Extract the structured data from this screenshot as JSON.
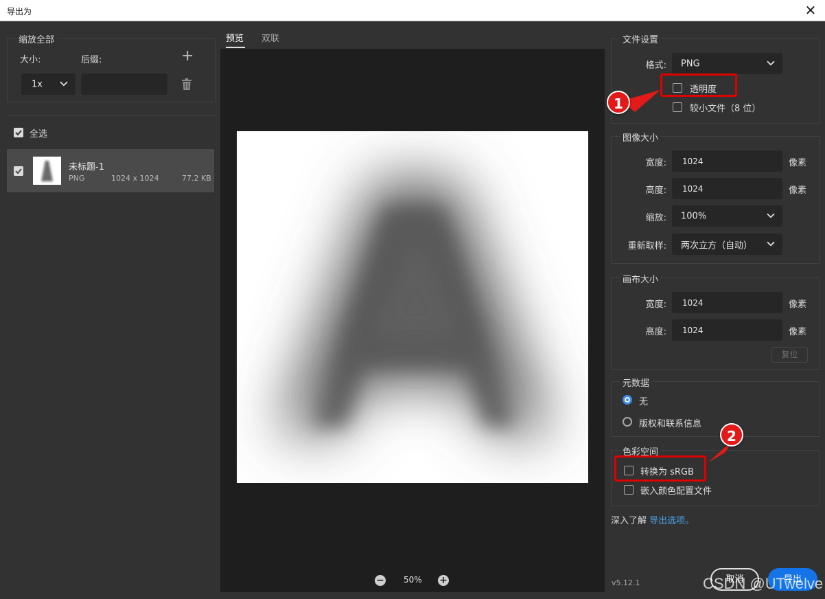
{
  "window": {
    "title": "导出为",
    "close_glyph": "✕"
  },
  "scale_all": {
    "legend": "缩放全部",
    "size_label": "大小:",
    "suffix_label": "后缀:",
    "size_value": "1x",
    "suffix_value": ""
  },
  "assets": {
    "select_all_label": "全选",
    "items": [
      {
        "name": "未标题-1",
        "format": "PNG",
        "dimensions": "1024 x 1024",
        "filesize": "77.2 KB"
      }
    ]
  },
  "preview": {
    "tabs": [
      {
        "label": "预览"
      },
      {
        "label": "双联"
      }
    ],
    "zoom": "50%"
  },
  "file_settings": {
    "legend": "文件设置",
    "format_label": "格式:",
    "format_value": "PNG",
    "transparency_label": "透明度",
    "smaller_file_label": "较小文件（8 位）"
  },
  "image_size": {
    "legend": "图像大小",
    "width_label": "宽度:",
    "width_value": "1024",
    "height_label": "高度:",
    "height_value": "1024",
    "unit": "像素",
    "scale_label": "缩放:",
    "scale_value": "100%",
    "resample_label": "重新取样:",
    "resample_value": "两次立方（自动）"
  },
  "canvas_size": {
    "legend": "画布大小",
    "width_label": "宽度:",
    "width_value": "1024",
    "height_label": "高度:",
    "height_value": "1024",
    "unit": "像素",
    "reset_label": "复位"
  },
  "metadata": {
    "legend": "元数据",
    "options": [
      {
        "label": "无",
        "selected": true
      },
      {
        "label": "版权和联系信息",
        "selected": false
      }
    ]
  },
  "color_space": {
    "legend": "色彩空间",
    "convert_srgb_label": "转换为 sRGB",
    "embed_profile_label": "嵌入颜色配置文件"
  },
  "learn_more": {
    "prefix": "深入了解",
    "link": "导出选项。"
  },
  "footer": {
    "version": "v5.12.1",
    "cancel_label": "取消",
    "export_label": "导出"
  },
  "annotations": {
    "badge1": "1",
    "badge2": "2"
  },
  "watermark": "CSDN @UTwelve",
  "colors": {
    "accent": "#1473e6",
    "annotation_red": "#e00000",
    "radio_selected": "#3b8bea",
    "link": "#4aa3f0"
  },
  "icons": [
    "close-icon",
    "plus-icon",
    "chevron-down-icon",
    "trash-icon",
    "checkbox-icon",
    "zoom-out-icon",
    "zoom-in-icon"
  ]
}
